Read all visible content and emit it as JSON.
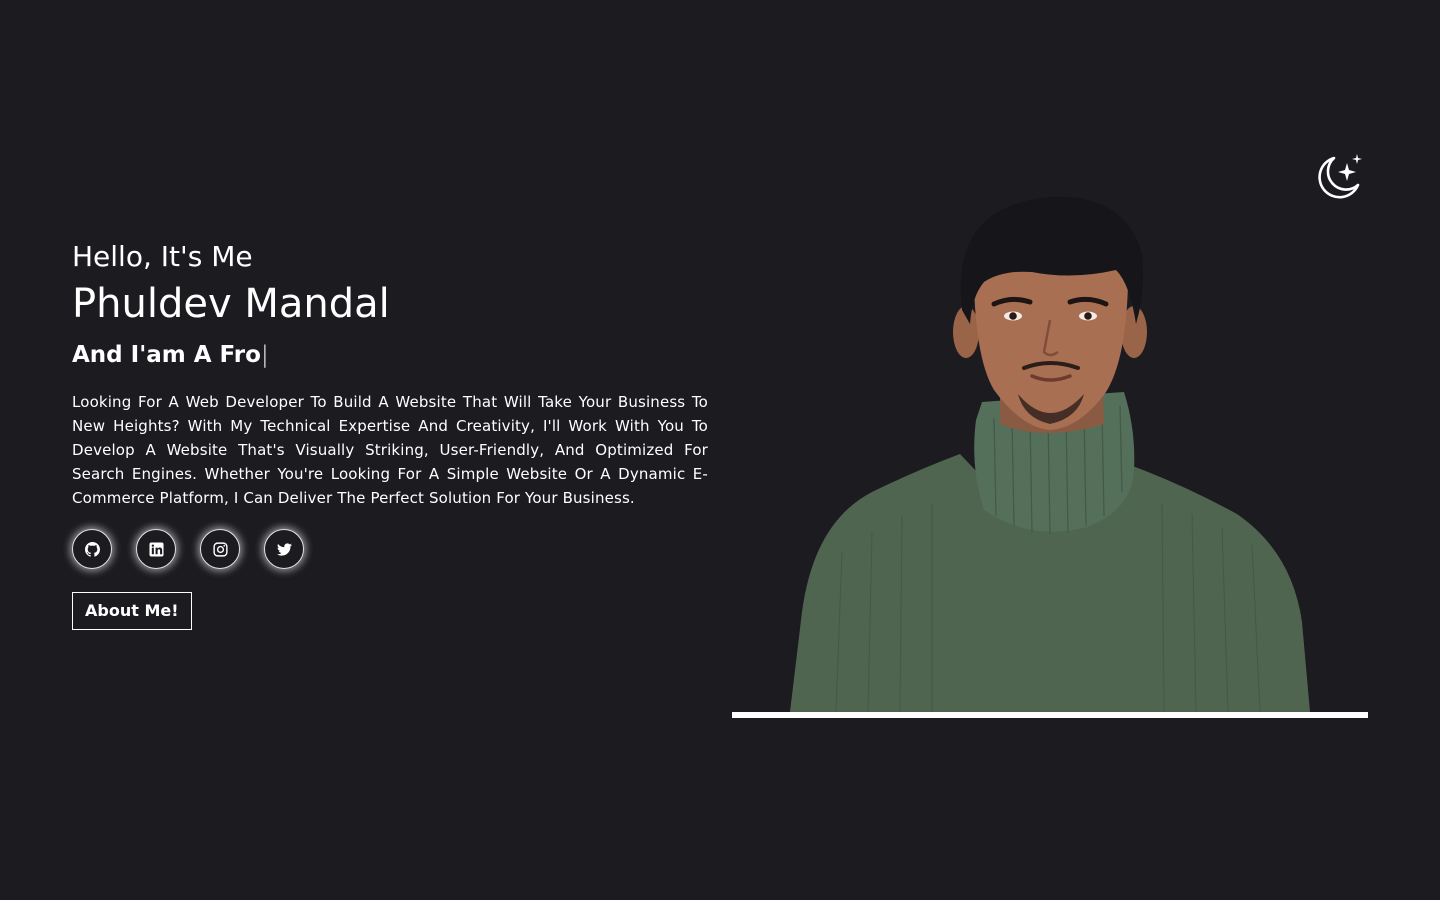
{
  "theme_toggle": {
    "icon": "moon-stars-icon"
  },
  "hero": {
    "greeting": "Hello, It's Me",
    "name": "Phuldev Mandal",
    "role_prefix": "And I'am A ",
    "role_typed": "Fro",
    "cursor": "|",
    "bio": "Looking For A Web Developer To Build A Website That Will Take Your Business To New Heights? With My Technical Expertise And Creativity, I'll Work With You To Develop A Website That's Visually Striking, User-Friendly, And Optimized For Search Engines. Whether You're Looking For A Simple Website Or A Dynamic E-Commerce Platform, I Can Deliver The Perfect Solution For Your Business.",
    "socials": [
      {
        "icon": "github-icon"
      },
      {
        "icon": "linkedin-icon"
      },
      {
        "icon": "instagram-icon"
      },
      {
        "icon": "twitter-icon"
      }
    ],
    "about_button": "About Me!"
  },
  "portrait": {
    "subject": "profile-photo"
  },
  "colors": {
    "background": "#1c1b20",
    "text": "#ffffff",
    "sweater": "#4f6550"
  }
}
